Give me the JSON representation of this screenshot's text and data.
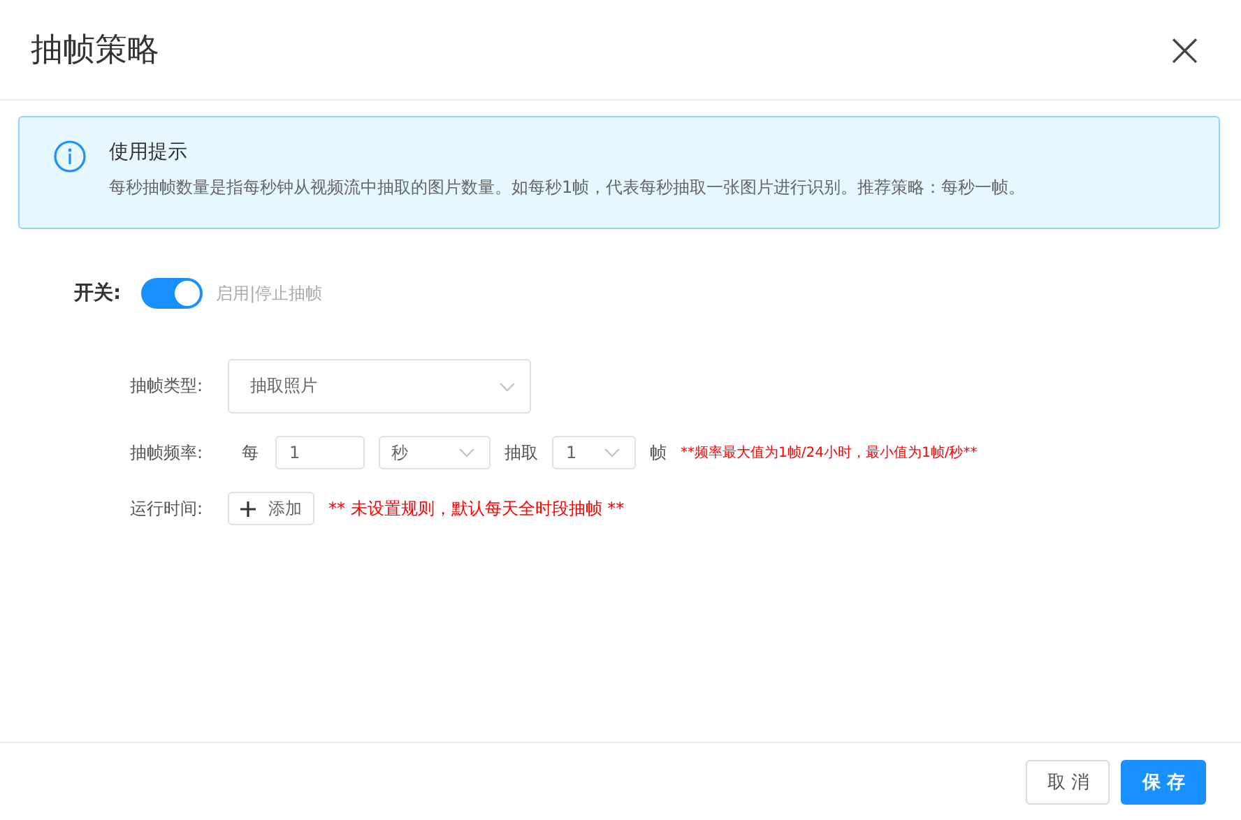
{
  "dialog": {
    "title": "抽帧策略",
    "close": "×"
  },
  "alert": {
    "title": "使用提示",
    "text": "每秒抽帧数量是指每秒钟从视频流中抽取的图片数量。如每秒1帧，代表每秒抽取一张图片进行识别。推荐策略：每秒一帧。"
  },
  "switch": {
    "label": "开关:",
    "on": true,
    "hint": "启用|停止抽帧"
  },
  "type_row": {
    "label": "抽帧类型:",
    "value": "抽取照片"
  },
  "frequency_row": {
    "label": "抽帧频率:",
    "every": "每",
    "interval": "1",
    "unit": "秒",
    "extract": "抽取",
    "count": "1",
    "frame": "帧",
    "note": "**频率最大值为1帧/24小时，最小值为1帧/秒**"
  },
  "time_row": {
    "label": "运行时间:",
    "add_button": "添加",
    "note": "** 未设置规则，默认每天全时段抽帧 **"
  },
  "footer": {
    "buttons": [
      {
        "label": "取 消",
        "kind": "default"
      },
      {
        "label": "保 存",
        "kind": "primary"
      }
    ]
  }
}
